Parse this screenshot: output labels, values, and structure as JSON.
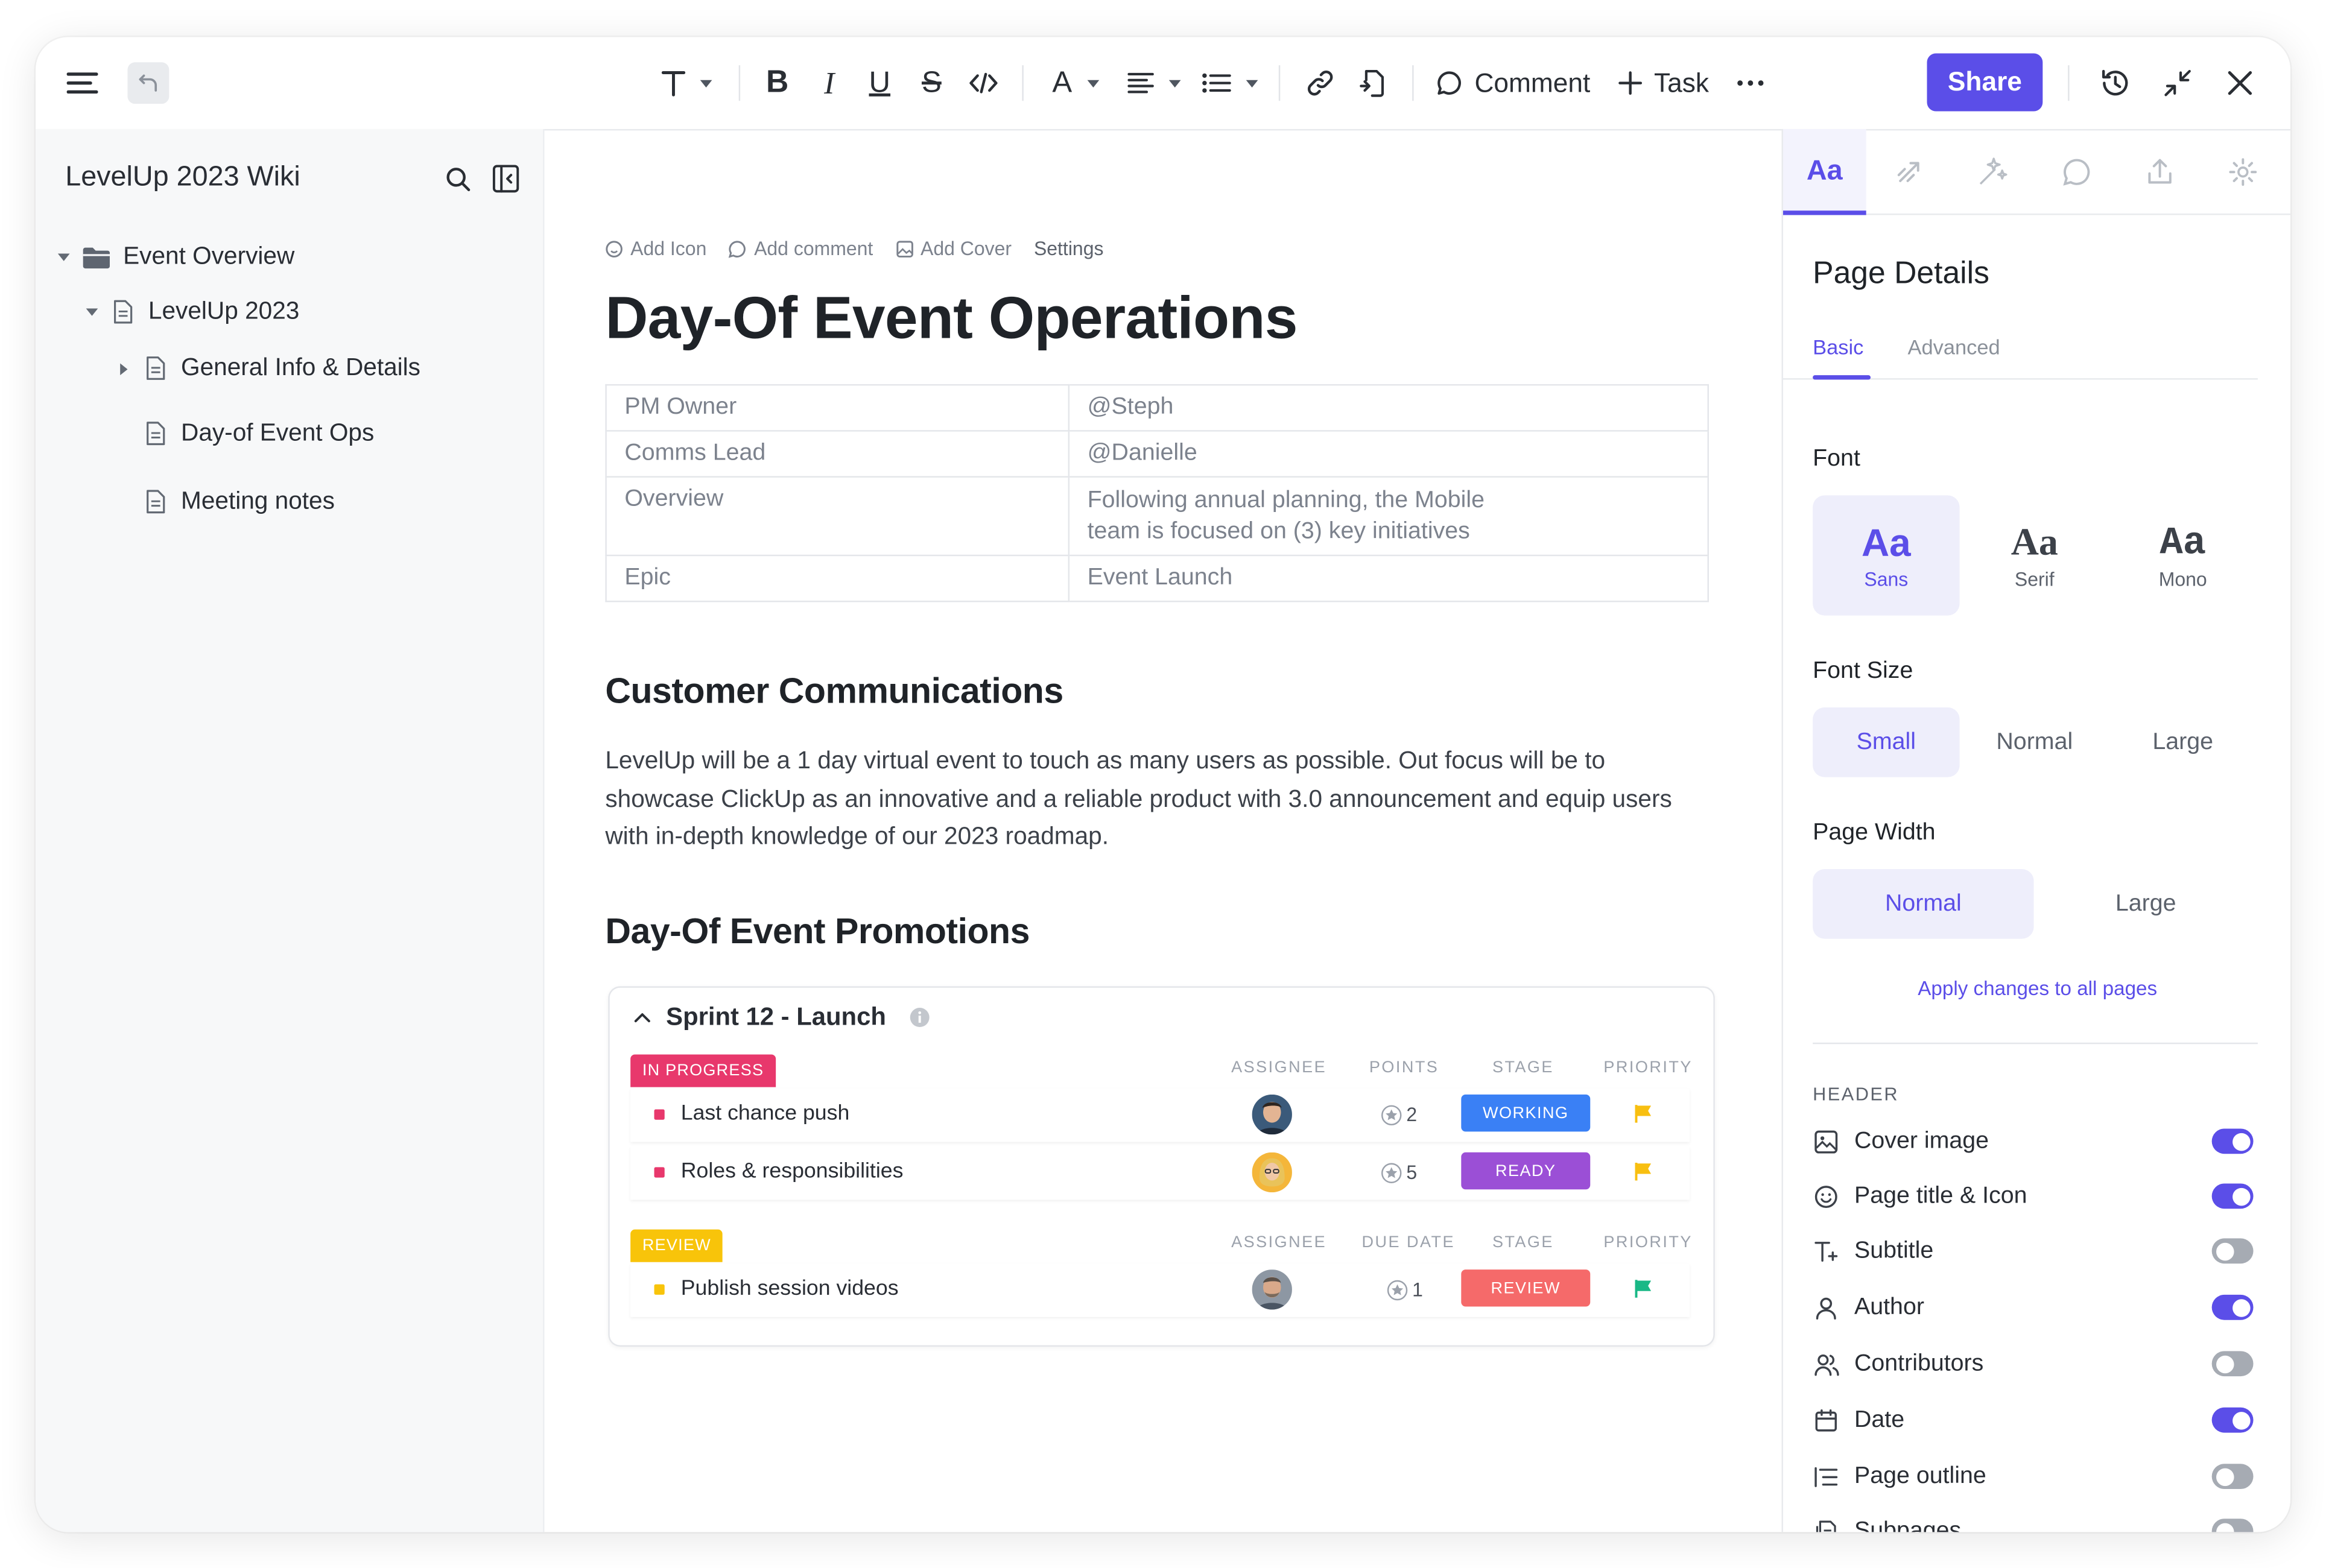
{
  "toolbar": {
    "comment_label": "Comment",
    "task_label": "Task",
    "share_label": "Share"
  },
  "sidebar": {
    "title": "LevelUp 2023 Wiki",
    "items": [
      {
        "label": "Event Overview"
      },
      {
        "label": "LevelUp 2023"
      },
      {
        "label": "General Info & Details"
      },
      {
        "label": "Day-of Event Ops"
      },
      {
        "label": "Meeting notes"
      }
    ]
  },
  "page": {
    "meta": {
      "add_icon": "Add Icon",
      "add_comment": "Add comment",
      "add_cover": "Add Cover",
      "settings": "Settings"
    },
    "title": "Day-Of Event Operations",
    "properties": [
      {
        "key": "PM Owner",
        "value": "@Steph"
      },
      {
        "key": "Comms Lead",
        "value": "@Danielle"
      },
      {
        "key": "Overview",
        "value_line1": "Following annual planning, the Mobile",
        "value_line2": "team is focused on (3) key initiatives"
      },
      {
        "key": "Epic",
        "value": "Event Launch"
      }
    ],
    "section1_heading": "Customer Communications",
    "section1_body": "LevelUp will be a 1 day virtual event to touch as many users as possible. Out focus will be to showcase ClickUp as an innovative and a reliable product with 3.0 announcement and equip users with in-depth knowledge of our 2023 roadmap.",
    "section2_heading": "Day-Of Event Promotions",
    "sprint": {
      "title": "Sprint 12 - Launch",
      "groups": [
        {
          "status": "IN PROGRESS",
          "status_color": "#e8386c",
          "columns": [
            "ASSIGNEE",
            "POINTS",
            "STAGE",
            "PRIORITY"
          ],
          "tasks": [
            {
              "name": "Last chance push",
              "points": "2",
              "stage": "WORKING",
              "stage_color": "#3a80f5",
              "priority_color": "#f8bf10"
            },
            {
              "name": "Roles & responsibilities",
              "points": "5",
              "stage": "READY",
              "stage_color": "#9b4fd6",
              "priority_color": "#f8bf10"
            }
          ]
        },
        {
          "status": "REVIEW",
          "status_color": "#f8c40a",
          "columns": [
            "ASSIGNEE",
            "DUE DATE",
            "STAGE",
            "PRIORITY"
          ],
          "tasks": [
            {
              "name": "Publish session videos",
              "points": "1",
              "stage": "REVIEW",
              "stage_color": "#f56a6a",
              "priority_color": "#19b886"
            }
          ]
        }
      ]
    }
  },
  "panel": {
    "active_tab": "Aa",
    "title": "Page Details",
    "subtabs": [
      "Basic",
      "Advanced"
    ],
    "font_label": "Font",
    "fonts": [
      {
        "sample": "Aa",
        "name": "Sans",
        "selected": true
      },
      {
        "sample": "Aa",
        "name": "Serif",
        "selected": false
      },
      {
        "sample": "Aa",
        "name": "Mono",
        "selected": false
      }
    ],
    "font_size_label": "Font Size",
    "font_sizes": [
      "Small",
      "Normal",
      "Large"
    ],
    "font_size_selected": "Small",
    "page_width_label": "Page Width",
    "page_widths": [
      "Normal",
      "Large"
    ],
    "page_width_selected": "Normal",
    "apply_link": "Apply changes to all pages",
    "header_label": "HEADER",
    "header_options": [
      {
        "label": "Cover image",
        "icon": "image-icon",
        "on": true
      },
      {
        "label": "Page title & Icon",
        "icon": "smiley-icon",
        "on": true
      },
      {
        "label": "Subtitle",
        "icon": "text-plus-icon",
        "on": false
      },
      {
        "label": "Author",
        "icon": "person-icon",
        "on": true
      },
      {
        "label": "Contributors",
        "icon": "people-icon",
        "on": false
      },
      {
        "label": "Date",
        "icon": "calendar-icon",
        "on": true
      },
      {
        "label": "Page outline",
        "icon": "outline-icon",
        "on": false
      },
      {
        "label": "Subpages",
        "icon": "subpages-icon",
        "on": false
      }
    ],
    "accent_color": "#5b4ee8"
  }
}
